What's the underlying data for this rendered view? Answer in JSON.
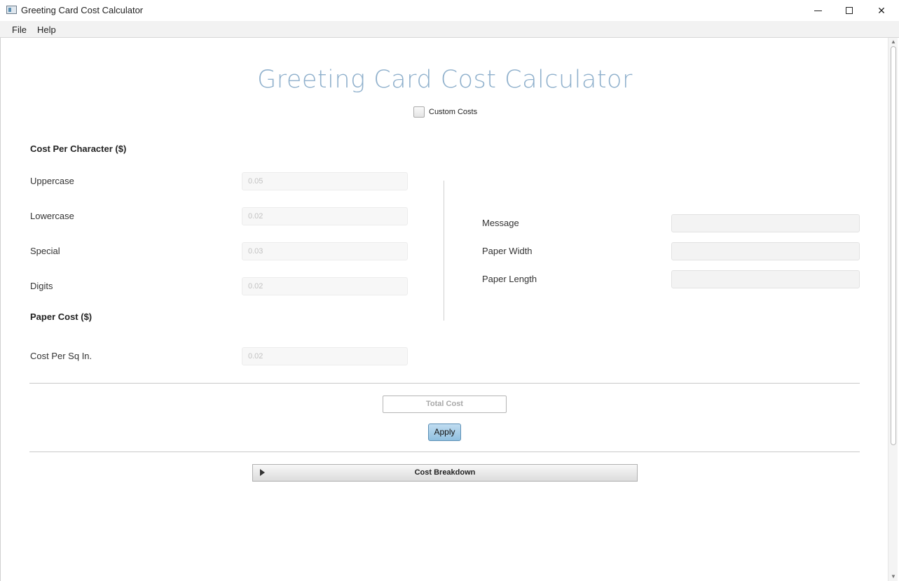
{
  "window": {
    "title": "Greeting Card Cost Calculator",
    "icon": "app-window-icon"
  },
  "menu": {
    "file": "File",
    "help": "Help"
  },
  "main": {
    "title": "Greeting Card Cost Calculator",
    "custom_costs_label": "Custom Costs",
    "custom_costs_checked": false
  },
  "character_costs": {
    "heading": "Cost Per Character ($)",
    "fields": [
      {
        "label": "Uppercase",
        "value": "0.05"
      },
      {
        "label": "Lowercase",
        "value": "0.02"
      },
      {
        "label": "Special",
        "value": "0.03"
      },
      {
        "label": "Digits",
        "value": "0.02"
      }
    ]
  },
  "paper_cost": {
    "heading": "Paper Cost ($)",
    "field": {
      "label": "Cost Per Sq In.",
      "value": "0.02"
    }
  },
  "inputs": {
    "message": {
      "label": "Message",
      "value": ""
    },
    "paper_width": {
      "label": "Paper Width",
      "value": ""
    },
    "paper_length": {
      "label": "Paper Length",
      "value": ""
    }
  },
  "actions": {
    "total_cost_label": "Total Cost",
    "apply_label": "Apply"
  },
  "breakdown": {
    "label": "Cost Breakdown",
    "expanded": false
  },
  "colors": {
    "title": "#8fb0cc",
    "apply_button": "#90c0e0"
  }
}
